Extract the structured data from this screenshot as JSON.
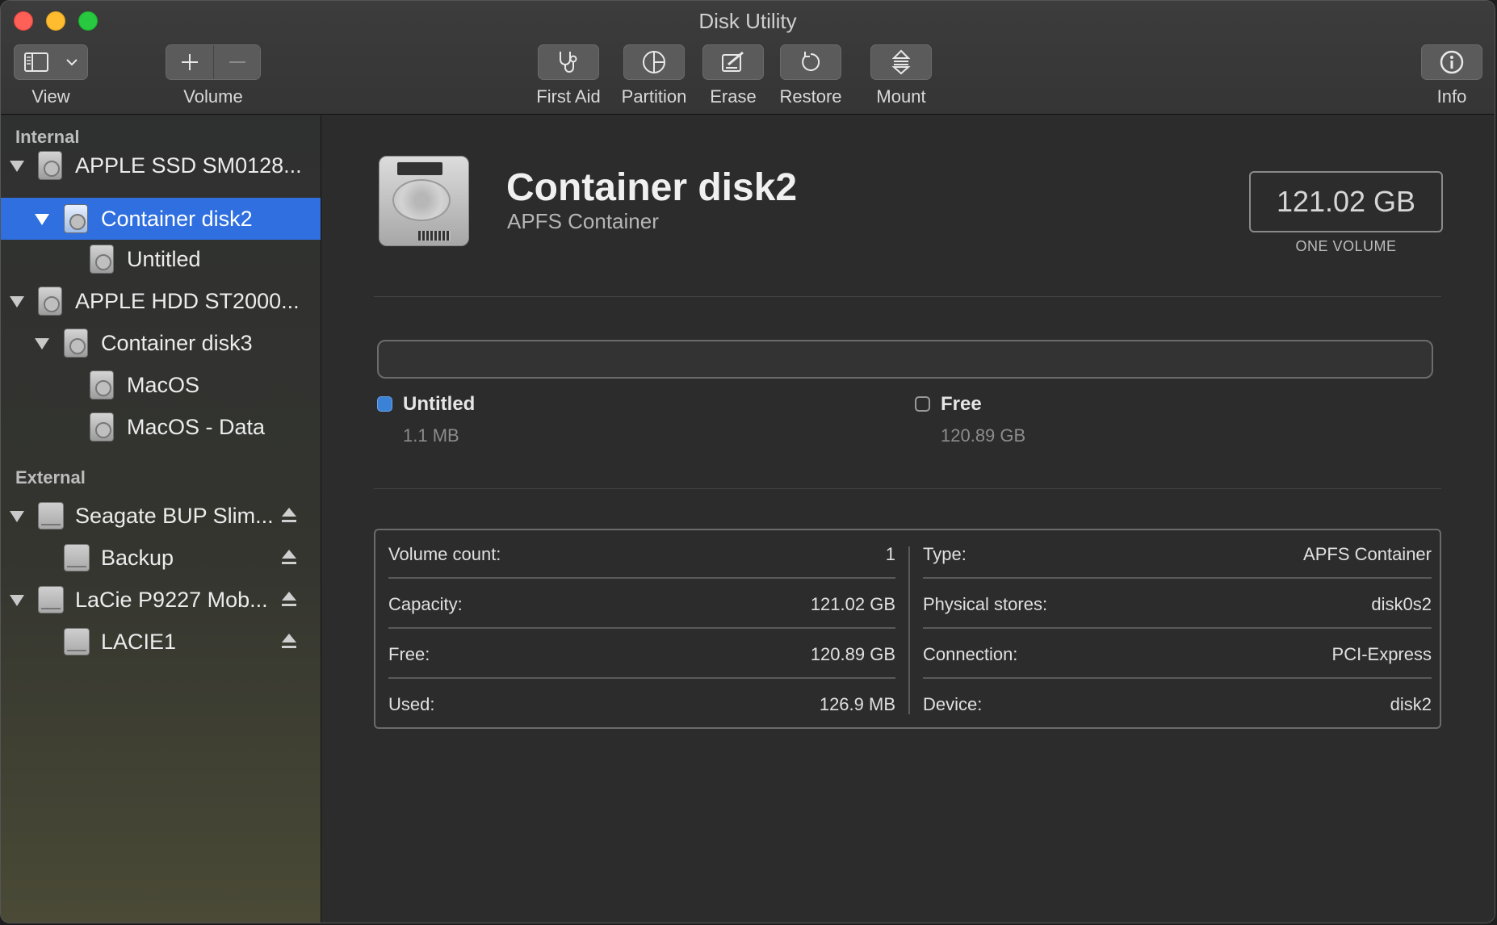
{
  "window": {
    "title": "Disk Utility"
  },
  "toolbar": {
    "view_label": "View",
    "volume_label": "Volume",
    "first_aid_label": "First Aid",
    "partition_label": "Partition",
    "erase_label": "Erase",
    "restore_label": "Restore",
    "mount_label": "Mount",
    "info_label": "Info"
  },
  "sidebar": {
    "internal_heading": "Internal",
    "external_heading": "External",
    "items": [
      {
        "label": "APPLE SSD SM0128..."
      },
      {
        "label": "Container disk2"
      },
      {
        "label": "Untitled"
      },
      {
        "label": "APPLE HDD ST2000..."
      },
      {
        "label": "Container disk3"
      },
      {
        "label": "MacOS"
      },
      {
        "label": "MacOS - Data"
      },
      {
        "label": "Seagate BUP Slim..."
      },
      {
        "label": "Backup"
      },
      {
        "label": "LaCie P9227 Mob..."
      },
      {
        "label": "LACIE1"
      }
    ]
  },
  "detail": {
    "title": "Container disk2",
    "subtitle": "APFS Container",
    "capacity": "121.02 GB",
    "capacity_caption": "ONE VOLUME",
    "legend": [
      {
        "name": "Untitled",
        "size": "1.1 MB",
        "color": "#3b82d6"
      },
      {
        "name": "Free",
        "size": "120.89 GB",
        "color": "#9a9a9a"
      }
    ],
    "info_left": [
      {
        "key": "Volume count:",
        "value": "1"
      },
      {
        "key": "Capacity:",
        "value": "121.02 GB"
      },
      {
        "key": "Free:",
        "value": "120.89 GB"
      },
      {
        "key": "Used:",
        "value": "126.9 MB"
      }
    ],
    "info_right": [
      {
        "key": "Type:",
        "value": "APFS Container"
      },
      {
        "key": "Physical stores:",
        "value": "disk0s2"
      },
      {
        "key": "Connection:",
        "value": "PCI-Express"
      },
      {
        "key": "Device:",
        "value": "disk2"
      }
    ]
  }
}
